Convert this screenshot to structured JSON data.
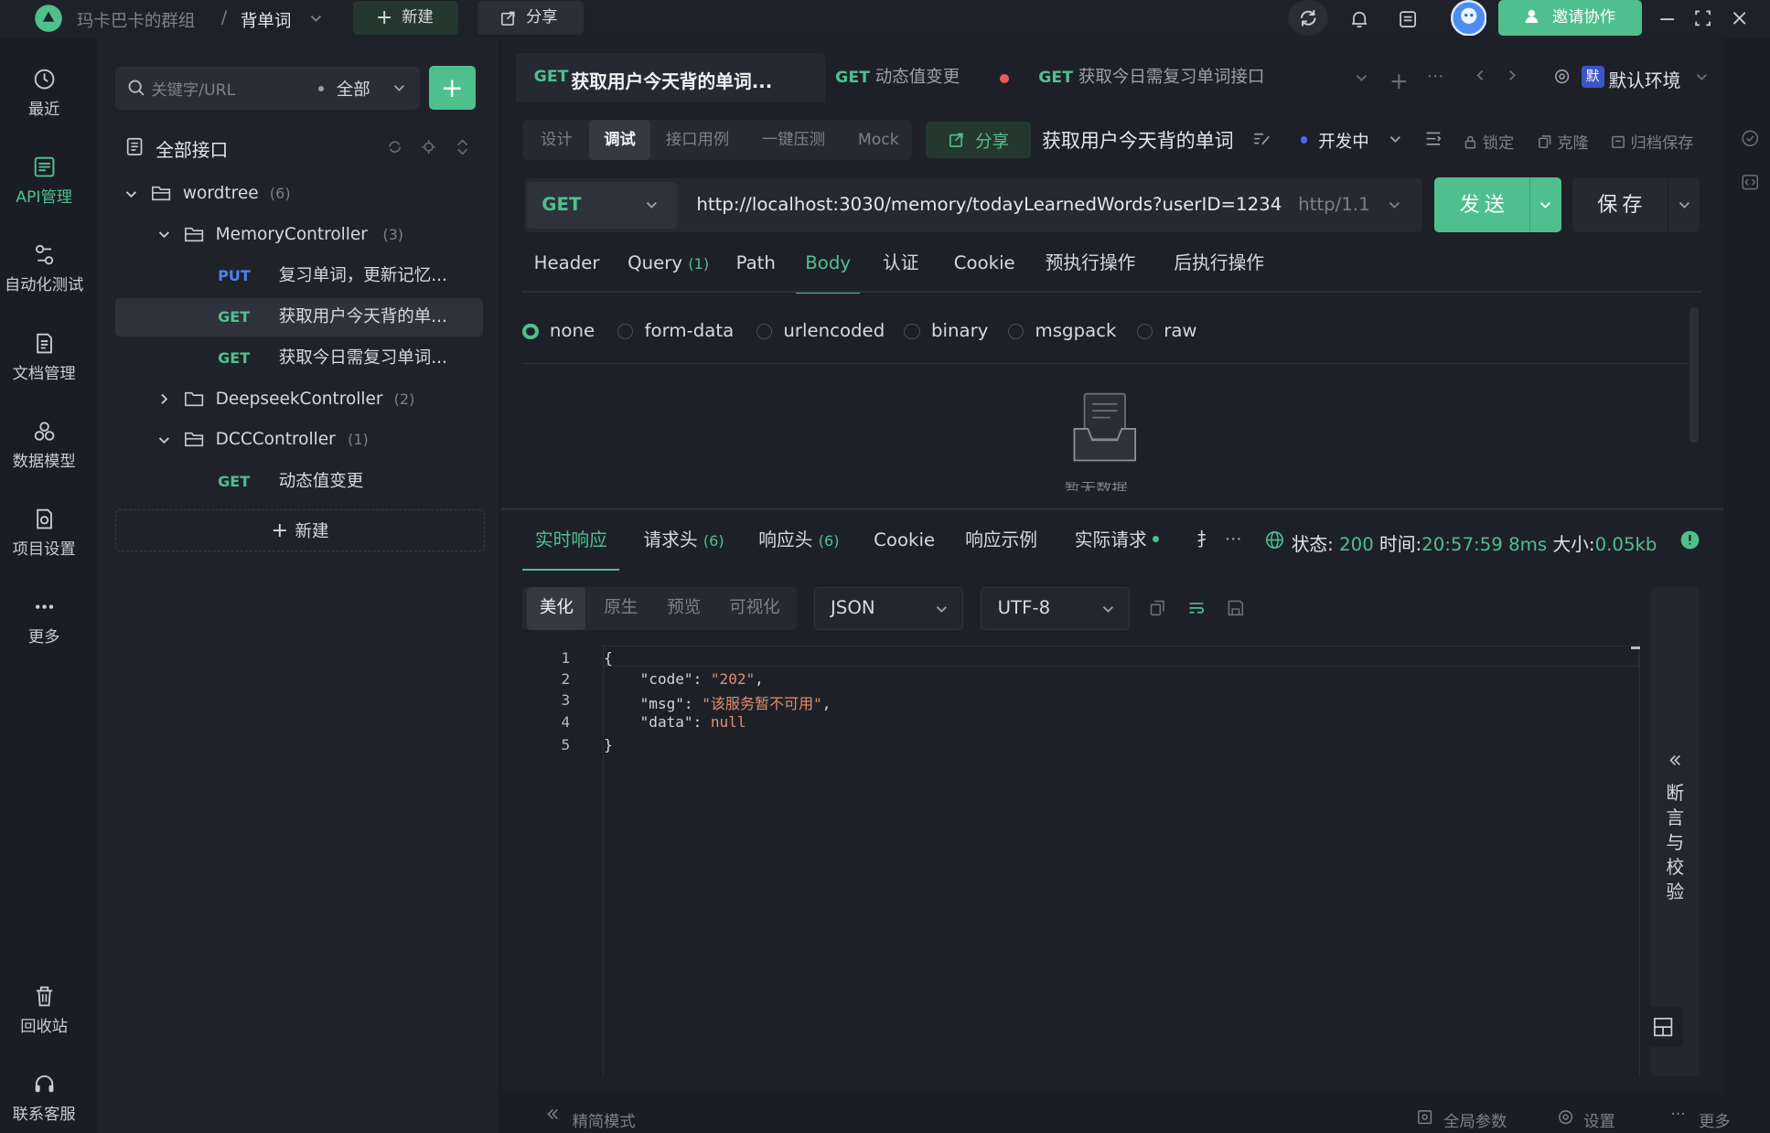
{
  "topbar": {
    "team": "玛卡巴卡的群组",
    "separator": "/",
    "project": "背单词",
    "new_label": "新建",
    "share_label": "分享",
    "invite_label": "邀请协作"
  },
  "rail": {
    "items": [
      {
        "label": "最近",
        "icon": "history-icon"
      },
      {
        "label": "API管理",
        "icon": "api-icon"
      },
      {
        "label": "自动化测试",
        "icon": "automation-icon"
      },
      {
        "label": "文档管理",
        "icon": "document-icon"
      },
      {
        "label": "数据模型",
        "icon": "data-model-icon"
      },
      {
        "label": "项目设置",
        "icon": "project-settings-icon"
      },
      {
        "label": "更多",
        "icon": "more-icon"
      },
      {
        "label": "回收站",
        "icon": "trash-icon"
      },
      {
        "label": "联系客服",
        "icon": "headset-icon"
      }
    ]
  },
  "tree": {
    "search_placeholder": "关键字/URL",
    "filter_label": "全部",
    "add_label": "+",
    "root_label": "全部接口",
    "nodes": [
      {
        "name": "wordtree",
        "count": "(6)"
      },
      {
        "name": "MemoryController",
        "count": "(3)"
      },
      {
        "method": "PUT",
        "name": "复习单词，更新记忆..."
      },
      {
        "method": "GET",
        "name": "获取用户今天背的单..."
      },
      {
        "method": "GET",
        "name": "获取今日需复习单词..."
      },
      {
        "name": "DeepseekController",
        "count": "(2)"
      },
      {
        "name": "DCCController",
        "count": "(1)"
      },
      {
        "method": "GET",
        "name": "动态值变更"
      }
    ],
    "new_label": "新建"
  },
  "tabs": [
    {
      "method": "GET",
      "title": "获取用户今天背的单词..."
    },
    {
      "method": "GET",
      "title": "动态值变更"
    },
    {
      "method": "GET",
      "title": "获取今日需复习单词接口"
    }
  ],
  "env": {
    "badge": "默",
    "label": "默认环境"
  },
  "subtabs": [
    "设计",
    "调试",
    "接口用例",
    "一键压测",
    "Mock"
  ],
  "request": {
    "share_label": "分享",
    "name": "获取用户今天背的单词",
    "status_label": "开发中",
    "lock_label": "锁定",
    "clone_label": "克隆",
    "archive_label": "归档保存",
    "method": "GET",
    "url": "http://localhost:3030/memory/todayLearnedWords?userID=1234",
    "protocol": "http/1.1",
    "send_label": "发送",
    "save_label": "保存"
  },
  "reqtabs": {
    "header": "Header",
    "query": "Query",
    "query_count": "(1)",
    "path": "Path",
    "body": "Body",
    "auth": "认证",
    "cookie": "Cookie",
    "pre": "预执行操作",
    "post": "后执行操作"
  },
  "body_types": [
    "none",
    "form-data",
    "urlencoded",
    "binary",
    "msgpack",
    "raw"
  ],
  "empty_text": "暂无数据",
  "response": {
    "tabs": {
      "realtime": "实时响应",
      "req_headers": "请求头",
      "req_headers_count": "(6)",
      "resp_headers": "响应头",
      "resp_headers_count": "(6)",
      "cookie": "Cookie",
      "example": "响应示例",
      "actual": "实际请求",
      "overflow": "扌"
    },
    "status_label": "状态:",
    "status_value": "200",
    "time_label": "时间:",
    "time_value": "20:57:59",
    "duration_value": "8ms",
    "size_label": "大小:",
    "size_value": "0.05kb",
    "views": [
      "美化",
      "原生",
      "预览",
      "可视化"
    ],
    "format": "JSON",
    "encoding": "UTF-8",
    "lines": [
      {
        "n": "1",
        "text": "{"
      },
      {
        "n": "2",
        "key": "\"code\"",
        "val": "\"202\"",
        "end": ","
      },
      {
        "n": "3",
        "key": "\"msg\"",
        "val": "\"该服务暂不可用\"",
        "end": ","
      },
      {
        "n": "4",
        "key": "\"data\"",
        "val": "null",
        "end": ""
      },
      {
        "n": "5",
        "text": "}"
      }
    ],
    "assert_label": "断言与校验"
  },
  "bottom": {
    "compact_label": "精简模式",
    "global_params": "全局参数",
    "settings": "设置",
    "more": "更多"
  }
}
